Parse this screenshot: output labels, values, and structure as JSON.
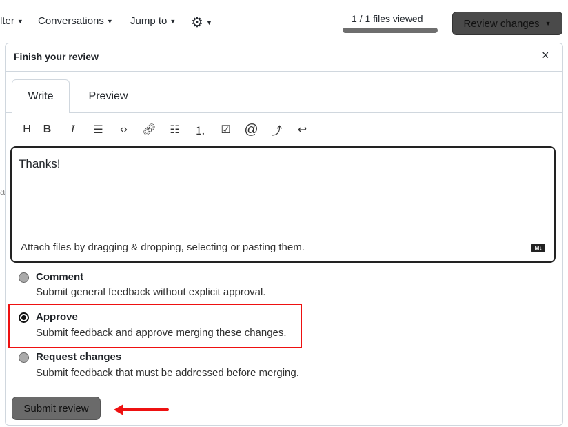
{
  "nav": {
    "filter": "lter",
    "conversations": "Conversations",
    "jump_to": "Jump to",
    "settings_icon": "gear-icon"
  },
  "progress": {
    "label": "1 / 1 files viewed",
    "fraction": 1.0
  },
  "review_button": "Review changes",
  "side_letter": "a",
  "dialog": {
    "title": "Finish your review",
    "close": "×",
    "tabs": [
      {
        "label": "Write",
        "active": true
      },
      {
        "label": "Preview",
        "active": false
      }
    ],
    "toolbar": [
      "H",
      "B",
      "I",
      "quote",
      "code",
      "link",
      "bulleted-list",
      "numbered-list",
      "task-list",
      "mention",
      "reference",
      "undo"
    ],
    "body": "Thanks!",
    "attach_hint": "Attach files by dragging & dropping, selecting or pasting them.",
    "markdown_badge": "M↓",
    "options": [
      {
        "label": "Comment",
        "desc": "Submit general feedback without explicit approval.",
        "selected": false
      },
      {
        "label": "Approve",
        "desc": "Submit feedback and approve merging these changes.",
        "selected": true
      },
      {
        "label": "Request changes",
        "desc": "Submit feedback that must be addressed before merging.",
        "selected": false
      }
    ],
    "submit": "Submit review",
    "highlight_color": "#e11111"
  }
}
